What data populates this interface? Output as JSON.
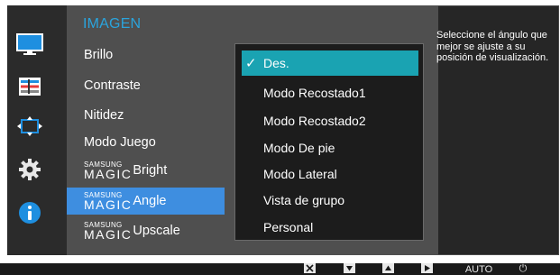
{
  "menu": {
    "title": "IMAGEN",
    "items": [
      {
        "label": "Brillo"
      },
      {
        "label": "Contraste"
      },
      {
        "label": "Nitidez"
      },
      {
        "label": "Modo Juego"
      },
      {
        "brand_small": "SAMSUNG",
        "brand_big": "MAGIC",
        "label": "Bright"
      },
      {
        "brand_small": "SAMSUNG",
        "brand_big": "MAGIC",
        "label": "Angle",
        "selected": true
      },
      {
        "brand_small": "SAMSUNG",
        "brand_big": "MAGIC",
        "label": "Upscale"
      }
    ]
  },
  "submenu": {
    "selected_mark": "✓",
    "options": [
      {
        "label": "Des.",
        "selected": true
      },
      {
        "label": "Modo Recostado1"
      },
      {
        "label": "Modo Recostado2"
      },
      {
        "label": "Modo De pie"
      },
      {
        "label": "Modo Lateral"
      },
      {
        "label": "Vista de grupo"
      },
      {
        "label": "Personal"
      }
    ]
  },
  "help_text": "Seleccione el ángulo que mejor se ajuste a su posición de visualización.",
  "sidebar_icons": [
    "monitor-icon",
    "color-bars-icon",
    "size-position-icon",
    "settings-gear-icon",
    "info-icon"
  ],
  "buttons": {
    "auto_label": "AUTO",
    "power_glyph": "⏻"
  },
  "colors": {
    "title_blue": "#2aa4dd",
    "selected_blue": "#3e8ee0",
    "option_teal": "#1aa3b2"
  }
}
